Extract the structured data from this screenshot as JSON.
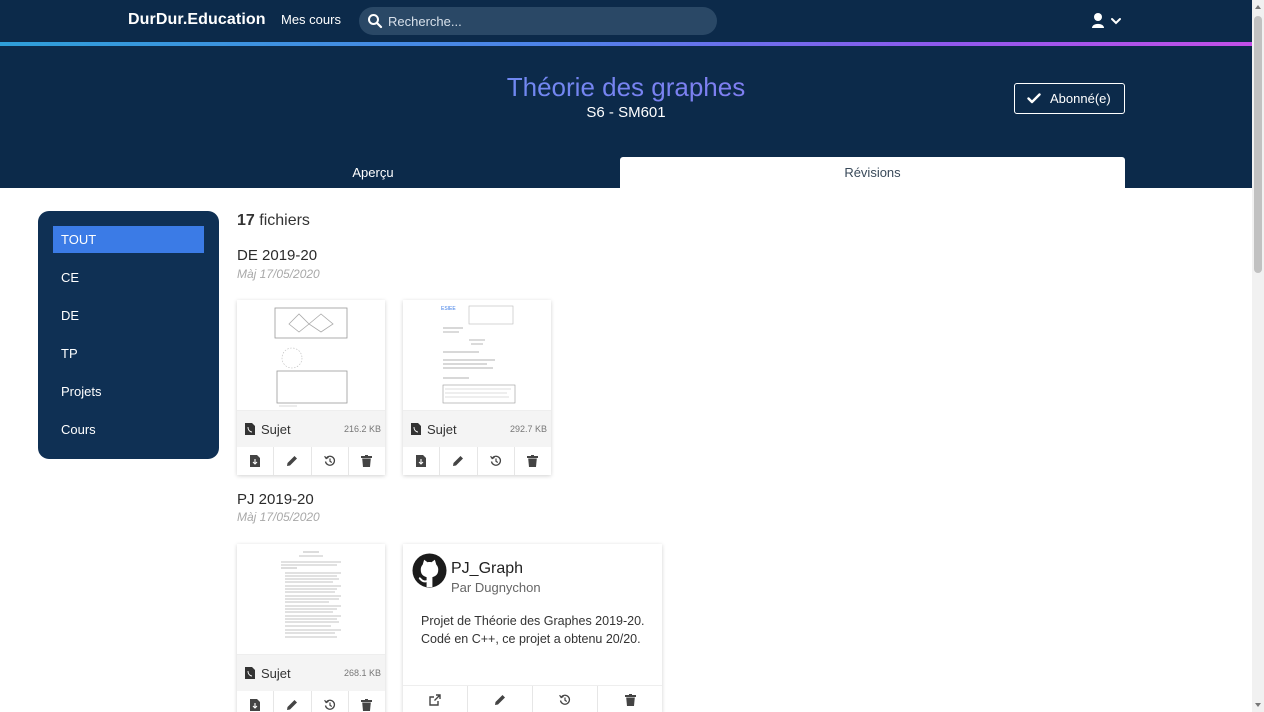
{
  "navbar": {
    "brand": "DurDur.Education",
    "my_courses": "Mes cours",
    "search_placeholder": "Recherche...",
    "bg_color": "#0c2a4a"
  },
  "hero": {
    "title": "Théorie des graphes",
    "code": "S6 - SM601",
    "subscribe_label": "Abonné(e)"
  },
  "tabs": [
    {
      "label": "Aperçu",
      "active": false
    },
    {
      "label": "Révisions",
      "active": true
    }
  ],
  "sidebar": {
    "items": [
      {
        "label": "TOUT",
        "active": true
      },
      {
        "label": "CE"
      },
      {
        "label": "DE"
      },
      {
        "label": "TP"
      },
      {
        "label": "Projets"
      },
      {
        "label": "Cours"
      }
    ],
    "accent": "#3b7be6"
  },
  "content": {
    "count_number": "17",
    "count_label": "fichiers",
    "sections": [
      {
        "title": "DE 2019-20",
        "date": "Màj 17/05/2020",
        "files": [
          {
            "label": "Sujet",
            "size": "216.2 KB"
          },
          {
            "label": "Sujet",
            "size": "292.7 KB"
          }
        ]
      },
      {
        "title": "PJ 2019-20",
        "date": "Màj 17/05/2020",
        "files": [
          {
            "label": "Sujet",
            "size": "268.1 KB"
          }
        ],
        "repo": {
          "name": "PJ_Graph",
          "author": "Par Dugnychon",
          "description": "Projet de Théorie des Graphes 2019-20. Codé en C++, ce projet a obtenu 20/20."
        }
      }
    ]
  },
  "icons": {
    "download": "download-icon",
    "edit": "pencil-icon",
    "history": "history-icon",
    "delete": "trash-icon",
    "external": "external-link-icon"
  }
}
